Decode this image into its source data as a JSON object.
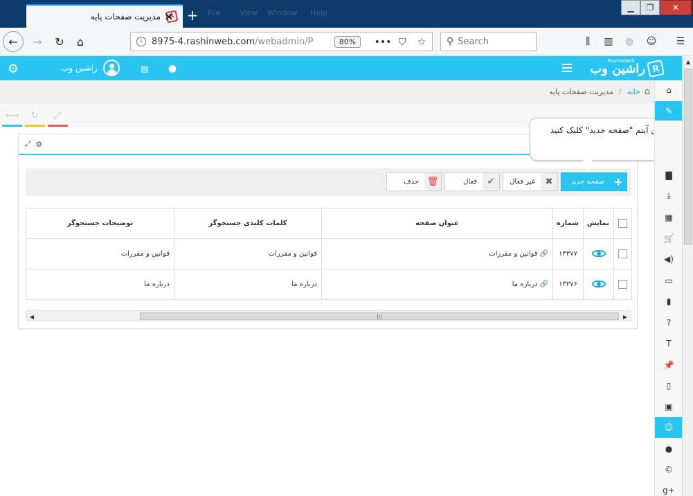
{
  "browser": {
    "tab_title": "مدیریت صفحات پایه",
    "tab_close": "✕",
    "new_tab": "+",
    "url_host": "8975-4.rashinweb.com",
    "url_path": "/webadmin/P",
    "zoom": "80%",
    "search_placeholder": "Search",
    "ghost_menu": [
      "File",
      "View",
      "Window",
      "Help"
    ]
  },
  "header": {
    "username": "راشین وب",
    "logo_text": "راشین وب",
    "logo_small": "RashinWeb"
  },
  "breadcrumb": {
    "home": "خانه",
    "separator": "/",
    "current": "مدیریت صفحات پایه"
  },
  "tooltip": {
    "text": "بر روی آیتم \"صفحه جدید\" کلیک کنید"
  },
  "toolbar": {
    "new_label": "صفحه جدید",
    "inactive_label": "غیر فعال",
    "active_label": "فعال",
    "delete_label": "حذف"
  },
  "table": {
    "headers": {
      "show": "نمایش",
      "number": "شماره",
      "title": "عنوان صفحه",
      "keywords": "کلمات کلیدی جستجوگر",
      "description": "توضیحات جستجوگر"
    },
    "rows": [
      {
        "number": "۱۳۳۷۷",
        "title": "قوانین و مقررات",
        "keywords": "قوانین و مقررات",
        "description": "قوانین و مقررات"
      },
      {
        "number": "۱۳۳۷۶",
        "title": "درباره ما",
        "keywords": "درباره ما",
        "description": "درباره ما"
      }
    ]
  },
  "colors": {
    "accent": "#2ac4f1",
    "titlebar": "#0d3b6a",
    "close_red": "#c9413a",
    "check_green": "#3aa63a",
    "delete_red": "#e03a3a"
  }
}
